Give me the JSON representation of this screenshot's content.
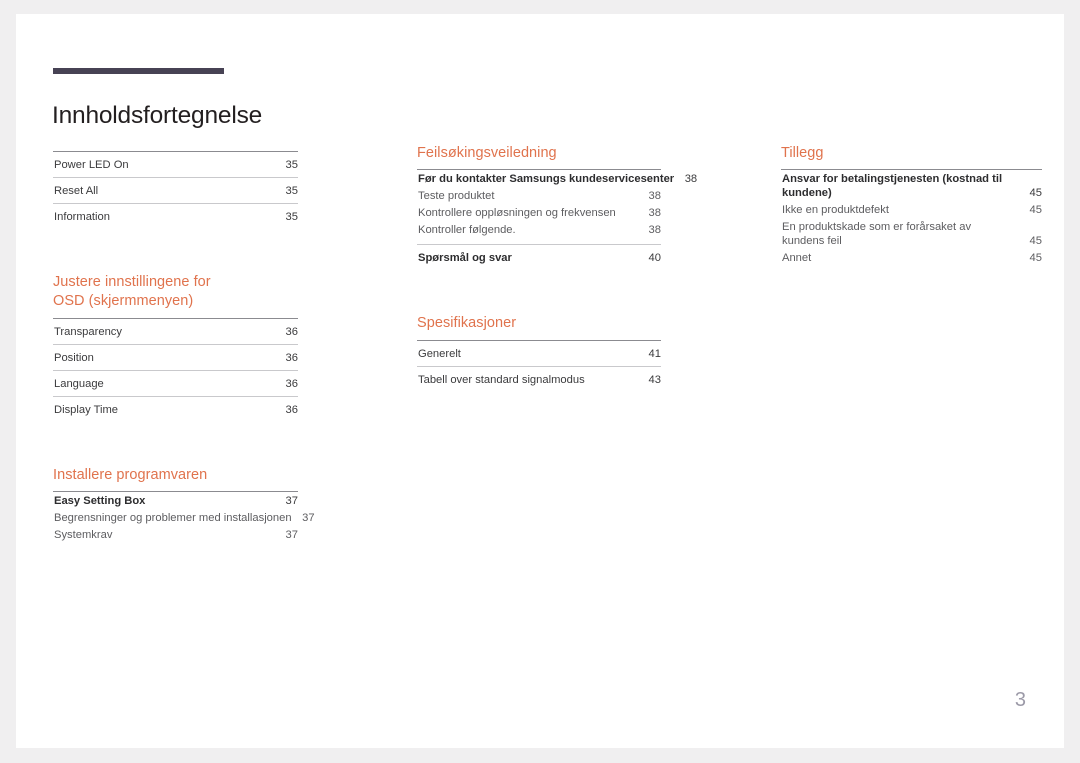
{
  "document": {
    "title": "Innholdsfortegnelse",
    "page_number": "3",
    "accent_color": "#e0734d",
    "rule_color": "#c9c9cc",
    "title_bar_color": "#474254",
    "folio_color": "#9c9aa8"
  },
  "columns": [
    {
      "name": "column-left",
      "sections": [
        {
          "heading": "",
          "entries": [
            {
              "label": "Power LED On",
              "page": "35",
              "level": "top"
            },
            {
              "label": "Reset All",
              "page": "35",
              "level": "top"
            },
            {
              "label": "Information",
              "page": "35",
              "level": "top"
            }
          ]
        },
        {
          "heading": "Justere innstillingene for OSD (skjermmenyen)",
          "heading_line1": "Justere innstillingene for",
          "heading_line2": "OSD (skjermmenyen)",
          "entries": [
            {
              "label": "Transparency",
              "page": "36",
              "level": "top"
            },
            {
              "label": "Position",
              "page": "36",
              "level": "top"
            },
            {
              "label": "Language",
              "page": "36",
              "level": "top"
            },
            {
              "label": "Display Time",
              "page": "36",
              "level": "top"
            }
          ]
        },
        {
          "heading": "Installere programvaren",
          "entries": [
            {
              "label": "Easy Setting Box",
              "page": "37",
              "level": "head"
            },
            {
              "label": "Begrensninger og problemer med installasjonen",
              "page": "37",
              "level": "sub"
            },
            {
              "label": "Systemkrav",
              "page": "37",
              "level": "sub"
            }
          ]
        }
      ]
    },
    {
      "name": "column-middle",
      "sections": [
        {
          "heading": "Feilsøkingsveiledning",
          "entries": [
            {
              "label": "Før du kontakter Samsungs kundeservicesenter",
              "page": "38",
              "level": "head"
            },
            {
              "label": "Teste produktet",
              "page": "38",
              "level": "sub"
            },
            {
              "label": "Kontrollere oppløsningen og frekvensen",
              "page": "38",
              "level": "sub"
            },
            {
              "label": "Kontroller følgende.",
              "page": "38",
              "level": "sub"
            },
            {
              "label": "Spørsmål og svar",
              "page": "40",
              "level": "head-ruled"
            }
          ]
        },
        {
          "heading": "Spesifikasjoner",
          "entries": [
            {
              "label": "Generelt",
              "page": "41",
              "level": "top"
            },
            {
              "label": "Tabell over standard signalmodus",
              "page": "43",
              "level": "top"
            }
          ]
        }
      ]
    },
    {
      "name": "column-right",
      "sections": [
        {
          "heading": "Tillegg",
          "entries": [
            {
              "label": "Ansvar for betalingstjenesten (kostnad til kundene)",
              "page": "45",
              "level": "head-wrap"
            },
            {
              "label": "Ikke en produktdefekt",
              "page": "45",
              "level": "sub"
            },
            {
              "label": "En produktskade som er forårsaket av kundens feil",
              "page": "45",
              "level": "sub-wrap"
            },
            {
              "label": "Annet",
              "page": "45",
              "level": "sub"
            }
          ]
        }
      ]
    }
  ]
}
